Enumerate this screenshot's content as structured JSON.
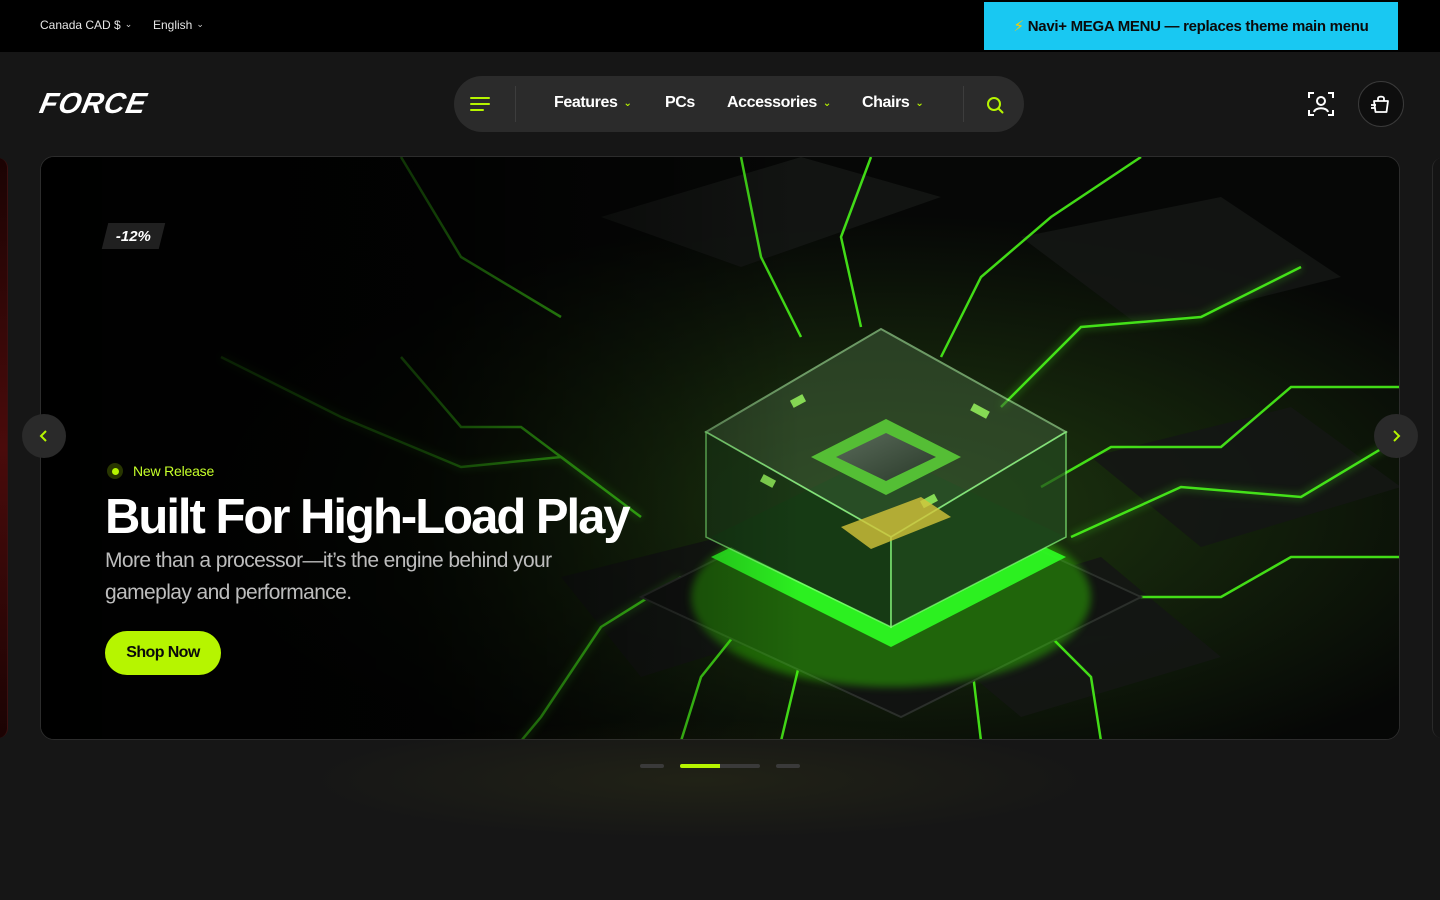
{
  "topbar": {
    "currency": "Canada CAD $",
    "language": "English",
    "banner_icon": "⚡",
    "banner_text": "Navi+ MEGA MENU — replaces theme main menu"
  },
  "header": {
    "logo": "FORCE",
    "nav": [
      {
        "label": "Features",
        "has_dropdown": true
      },
      {
        "label": "PCs",
        "has_dropdown": false
      },
      {
        "label": "Accessories",
        "has_dropdown": true
      },
      {
        "label": "Chairs",
        "has_dropdown": true
      }
    ],
    "icons": [
      "menu-icon",
      "search-icon",
      "account-icon",
      "cart-icon"
    ]
  },
  "hero": {
    "badge": "-12%",
    "tag": "New Release",
    "title": "Built For High-Load Play",
    "subtitle": "More than a processor—it’s the engine behind your gameplay and performance.",
    "cta": "Shop Now",
    "current_slide": 2,
    "slide_count": 3,
    "progress": 0.5
  },
  "colors": {
    "accent": "#b6f500",
    "banner": "#19c8f2",
    "background": "#161616"
  }
}
